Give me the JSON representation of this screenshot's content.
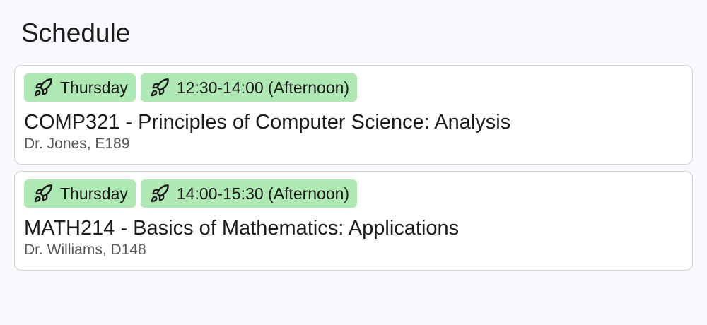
{
  "page": {
    "title": "Schedule"
  },
  "classes": [
    {
      "day": "Thursday",
      "time": "12:30-14:00 (Afternoon)",
      "course": "COMP321 - Principles of Computer Science: Analysis",
      "details": "Dr. Jones, E189"
    },
    {
      "day": "Thursday",
      "time": "14:00-15:30 (Afternoon)",
      "course": "MATH214 - Basics of Mathematics: Applications",
      "details": "Dr. Williams, D148"
    }
  ],
  "icons": {
    "tag_icon": "rocket-icon"
  },
  "colors": {
    "tag_background": "#aee8b3",
    "card_border": "#d2d2d2",
    "page_background": "#f8f9fd",
    "meta_text": "#555555"
  }
}
